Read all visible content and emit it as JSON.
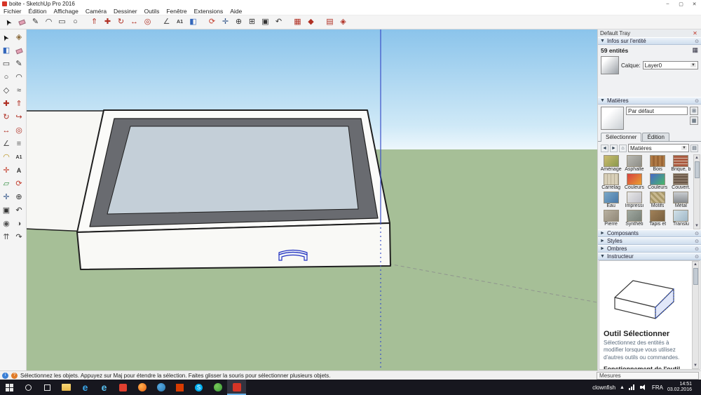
{
  "window": {
    "title": "boite - SketchUp Pro 2016"
  },
  "icons": {
    "minimize": "–",
    "maximize": "▢",
    "close": "✕",
    "chevron_down": "▼",
    "chevron_right": "►",
    "up": "▲",
    "down": "▼",
    "left": "◄",
    "right": "►",
    "home": "⌂",
    "combo_arrow": "▼",
    "detail_grid": "▦",
    "sample_paint": "▤",
    "create_material": "⊞",
    "pin": "⊙",
    "info": "i",
    "help": "?"
  },
  "menu": {
    "items": [
      {
        "name": "menu-fichier",
        "label": "Fichier"
      },
      {
        "name": "menu-edition",
        "label": "Édition"
      },
      {
        "name": "menu-affichage",
        "label": "Affichage"
      },
      {
        "name": "menu-camera",
        "label": "Caméra"
      },
      {
        "name": "menu-dessiner",
        "label": "Dessiner"
      },
      {
        "name": "menu-outils",
        "label": "Outils"
      },
      {
        "name": "menu-fenetre",
        "label": "Fenêtre"
      },
      {
        "name": "menu-extensions",
        "label": "Extensions"
      },
      {
        "name": "menu-aide",
        "label": "Aide"
      }
    ]
  },
  "toolbar": {
    "icons": [
      {
        "name": "select-tool",
        "glyph": "➤",
        "style": "color:#111;transform:rotate(-120deg)"
      },
      {
        "name": "eraser-tool",
        "glyph": "",
        "style": "background:#e2a0b4;width:9px;height:6px;transform:rotate(-20deg);border:1px solid #9a6a7a"
      },
      {
        "name": "line-tool",
        "glyph": "✎",
        "style": "color:#333"
      },
      {
        "name": "arc-tool",
        "glyph": "◠",
        "style": "color:#333"
      },
      {
        "name": "rectangle-tool",
        "glyph": "▭",
        "style": "color:#333"
      },
      {
        "name": "circle-tool",
        "glyph": "○",
        "style": "color:#333"
      },
      {
        "name": "toolbar-separator",
        "glyph": "",
        "cls": "tb-gap",
        "inter": "false"
      },
      {
        "name": "push-pull-tool",
        "glyph": "⇑",
        "style": "color:#b03024"
      },
      {
        "name": "move-tool",
        "glyph": "✚",
        "style": "color:#b03024"
      },
      {
        "name": "rotate-tool",
        "glyph": "↻",
        "style": "color:#b03024"
      },
      {
        "name": "scale-tool",
        "glyph": "↔",
        "style": "color:#b03024"
      },
      {
        "name": "offset-tool",
        "glyph": "◎",
        "style": "color:#b03024"
      },
      {
        "name": "toolbar-separator",
        "glyph": "",
        "cls": "tb-gap",
        "inter": "false"
      },
      {
        "name": "tape-measure-tool",
        "glyph": "∠",
        "style": "color:#555"
      },
      {
        "name": "text-tool",
        "glyph": "A1",
        "style": "font-size:7px;font-weight:bold;color:#333"
      },
      {
        "name": "paint-bucket-tool",
        "glyph": "◧",
        "style": "color:#3366bb"
      },
      {
        "name": "toolbar-separator",
        "glyph": "",
        "cls": "tb-gap",
        "inter": "false"
      },
      {
        "name": "orbit-tool",
        "glyph": "⟳",
        "style": "color:#c23b2a"
      },
      {
        "name": "pan-tool",
        "glyph": "✛",
        "style": "color:#335588"
      },
      {
        "name": "zoom-tool",
        "glyph": "⊕",
        "style": "color:#333"
      },
      {
        "name": "zoom-window-tool",
        "glyph": "⊞",
        "style": "color:#333"
      },
      {
        "name": "zoom-extents-tool",
        "glyph": "▣",
        "style": "color:#333"
      },
      {
        "name": "previous-view-tool",
        "glyph": "↶",
        "style": "color:#333"
      },
      {
        "name": "toolbar-separator",
        "glyph": "",
        "cls": "tb-gap",
        "inter": "false"
      },
      {
        "name": "shadows-toggle",
        "glyph": "▦",
        "style": "color:#b03024"
      },
      {
        "name": "styles-tool",
        "glyph": "◆",
        "style": "color:#b03024"
      },
      {
        "name": "toolbar-separator",
        "glyph": "",
        "cls": "tb-gap",
        "inter": "false"
      },
      {
        "name": "layers-tool",
        "glyph": "▤",
        "style": "color:#b03024"
      },
      {
        "name": "model-info-tool",
        "glyph": "◈",
        "style": "color:#b03024"
      }
    ]
  },
  "left_toolbar": {
    "icons": [
      {
        "name": "select-tool",
        "glyph": "➤",
        "style": "color:#111;transform:rotate(-120deg)"
      },
      {
        "name": "make-component-tool",
        "glyph": "◈",
        "style": "color:#8a6a3a"
      },
      {
        "name": "paint-bucket-tool",
        "glyph": "◧",
        "style": "color:#3366bb"
      },
      {
        "name": "eraser-tool",
        "glyph": "",
        "style": "background:#e2a0b4;width:9px;height:6px;transform:rotate(-20deg);border:1px solid #9a6a7a"
      },
      {
        "name": "rectangle-tool",
        "glyph": "▭",
        "style": "color:#333"
      },
      {
        "name": "line-tool",
        "glyph": "✎",
        "style": "color:#333"
      },
      {
        "name": "circle-tool",
        "glyph": "○",
        "style": "color:#333"
      },
      {
        "name": "arc-tool",
        "glyph": "◠",
        "style": "color:#333"
      },
      {
        "name": "polygon-tool",
        "glyph": "◇",
        "style": "color:#333"
      },
      {
        "name": "freehand-tool",
        "glyph": "≈",
        "style": "color:#333"
      },
      {
        "name": "move-tool",
        "glyph": "✚",
        "style": "color:#b03024"
      },
      {
        "name": "push-pull-tool",
        "glyph": "⇑",
        "style": "color:#b03024"
      },
      {
        "name": "rotate-tool",
        "glyph": "↻",
        "style": "color:#b03024"
      },
      {
        "name": "follow-me-tool",
        "glyph": "↪",
        "style": "color:#b03024"
      },
      {
        "name": "scale-tool",
        "glyph": "↔",
        "style": "color:#b03024"
      },
      {
        "name": "offset-tool",
        "glyph": "◎",
        "style": "color:#b03024"
      },
      {
        "name": "tape-measure-tool",
        "glyph": "∠",
        "style": "color:#555"
      },
      {
        "name": "dimension-tool",
        "glyph": "≡",
        "style": "color:#555"
      },
      {
        "name": "protractor-tool",
        "glyph": "◠",
        "style": "color:#b8901a"
      },
      {
        "name": "text-tool",
        "glyph": "A1",
        "style": "font-size:7px;font-weight:bold;color:#333"
      },
      {
        "name": "axes-tool",
        "glyph": "✛",
        "style": "color:#c23b2a"
      },
      {
        "name": "3d-text-tool",
        "glyph": "A",
        "style": "font-weight:bold;color:#333;font-size:9px"
      },
      {
        "name": "section-plane-tool",
        "glyph": "▱",
        "style": "color:#2a8a3a"
      },
      {
        "name": "orbit-tool",
        "glyph": "⟳",
        "style": "color:#c23b2a"
      },
      {
        "name": "pan-tool",
        "glyph": "✛",
        "style": "color:#335588"
      },
      {
        "name": "zoom-tool",
        "glyph": "⊕",
        "style": "color:#333"
      },
      {
        "name": "zoom-extents-tool",
        "glyph": "▣",
        "style": "color:#333"
      },
      {
        "name": "previous-view-tool",
        "glyph": "↶",
        "style": "color:#333"
      },
      {
        "name": "position-camera-tool",
        "glyph": "◉",
        "style": "color:#555"
      },
      {
        "name": "look-around-tool",
        "glyph": "◑",
        "style": "color:#555"
      },
      {
        "name": "walk-tool",
        "glyph": "⇈",
        "style": "color:#555"
      },
      {
        "name": "next-view-tool",
        "glyph": "↷",
        "style": "color:#333"
      }
    ]
  },
  "viewport": {
    "colors": {
      "sky_top": "#8bc4eb",
      "sky_horizon": "#eef7fc",
      "ground": "#a6bf97",
      "building_white": "#fbfbf9",
      "slope_frame_gray": "#696b70",
      "glass": "#c4cfd8",
      "edge": "#1f1f1f",
      "axis_blue": "#3a4fc8",
      "selection_blue": "#2433c0"
    }
  },
  "tray": {
    "title": "Default Tray",
    "entity_info": {
      "title": "Infos sur l'entité",
      "count": "59 entités",
      "layer_label": "Calque:",
      "layer_value": "Layer0"
    },
    "materials": {
      "title": "Matières",
      "current": "Par défaut",
      "tab_select": "Sélectionner",
      "tab_edit": "Édition",
      "dropdown": "Matières",
      "swatches": [
        {
          "name": "material-amenagement",
          "label": "Aménage",
          "thumb": "background:linear-gradient(135deg,#cdbb6e,#8a9a4e)"
        },
        {
          "name": "material-asphalte",
          "label": "Asphalte",
          "thumb": "background:linear-gradient(135deg,#b9b9b3,#8d8d87)"
        },
        {
          "name": "material-bois",
          "label": "Bois",
          "thumb": "background:repeating-linear-gradient(90deg,#b07a45 0,#b07a45 3px,#9a6636 3px,#9a6636 6px)"
        },
        {
          "name": "material-brique",
          "label": "Brique, b",
          "thumb": "background:repeating-linear-gradient(0deg,#aa5a40 0,#aa5a40 3px,#d8c0b0 3px,#d8c0b0 4px)"
        },
        {
          "name": "material-carrelage",
          "label": "Carrelag",
          "thumb": "background:repeating-linear-gradient(90deg,#d8cfb8 0,#d8cfb8 4px,#b8af98 4px,#b8af98 5px)"
        },
        {
          "name": "material-couleurs",
          "label": "Couleurs",
          "thumb": "background:linear-gradient(135deg,#d84040,#e8a030)"
        },
        {
          "name": "material-couleurs-nommees",
          "label": "Couleurs",
          "thumb": "background:linear-gradient(135deg,#4868c8,#48b868)"
        },
        {
          "name": "material-couvertures",
          "label": "Couvert.",
          "thumb": "background:repeating-linear-gradient(0deg,#8a7868 0,#8a7868 2px,#6a5848 2px,#6a5848 4px)"
        },
        {
          "name": "material-eau",
          "label": "Eau",
          "thumb": "background:linear-gradient(135deg,#7aa8c8,#4878a8)"
        },
        {
          "name": "material-impression",
          "label": "Impressi",
          "thumb": "background:linear-gradient(135deg,#e8e8e8,#c0c0c8)"
        },
        {
          "name": "material-motifs",
          "label": "Motifs",
          "thumb": "background:repeating-linear-gradient(45deg,#c8b890 0,#c8b890 3px,#a89868 3px,#a89868 6px)"
        },
        {
          "name": "material-metal",
          "label": "Métal",
          "thumb": "background:linear-gradient(180deg,#c8ccd0,#888c90)"
        },
        {
          "name": "material-pierre",
          "label": "Pierre",
          "thumb": "background:linear-gradient(135deg,#b8b0a0,#908878)"
        },
        {
          "name": "material-synthetique",
          "label": "Synthéti",
          "thumb": "background:linear-gradient(135deg,#a0a8a0,#788078)"
        },
        {
          "name": "material-tapis",
          "label": "Tapis et",
          "thumb": "background:linear-gradient(135deg,#a08058,#786040)"
        },
        {
          "name": "material-translucide",
          "label": "Translu",
          "thumb": "background:linear-gradient(135deg,#d0e0e8,#a0b8c8)"
        }
      ]
    },
    "sections": [
      {
        "name": "section-composants",
        "label": "Composants"
      },
      {
        "name": "section-styles",
        "label": "Styles"
      },
      {
        "name": "section-ombres",
        "label": "Ombres"
      }
    ],
    "instructor": {
      "title": "Instructeur",
      "heading": "Outil Sélectionner",
      "body": "Sélectionnez des entités à modifier lorsque vous utilisez d'autres outils ou commandes.",
      "subheading": "Fonctionnement de l'outil"
    }
  },
  "statusbar": {
    "message": "Sélectionnez les objets. Appuyez sur Maj pour étendre la sélection. Faites glisser la souris pour sélectionner plusieurs objets.",
    "measure_label": "Mesures"
  },
  "taskbar": {
    "apps": [
      {
        "name": "taskbar-file-explorer",
        "glyph": "",
        "style": "background:linear-gradient(180deg,#f8d878,#e8b84a);width:13px;height:10px;border-radius:1px"
      },
      {
        "name": "taskbar-edge",
        "glyph": "e",
        "style": "color:#3ba7ea;font-weight:bold;font-size:14px"
      },
      {
        "name": "taskbar-internet-explorer",
        "glyph": "e",
        "style": "color:#58c0f0;font-weight:bold;font-size:14px"
      },
      {
        "name": "taskbar-pdf-reader",
        "glyph": "",
        "style": "background:#e04030;width:11px;height:11px;border-radius:2px"
      },
      {
        "name": "taskbar-firefox",
        "glyph": "",
        "style": "background:radial-gradient(circle at 35% 35%,#ffb050,#e86010);width:12px;height:12px;border-radius:50%"
      },
      {
        "name": "taskbar-thunderbird",
        "glyph": "",
        "style": "background:radial-gradient(circle at 35% 35%,#58a8e0,#2878b0);width:12px;height:12px;border-radius:50%"
      },
      {
        "name": "taskbar-office",
        "glyph": "",
        "style": "background:#d83b01;width:11px;height:11px"
      },
      {
        "name": "taskbar-skype",
        "glyph": "S",
        "style": "color:#fff;background:#00aff0;width:11px;height:11px;border-radius:50%;font-size:8px;text-align:center;line-height:11px"
      },
      {
        "name": "taskbar-openoffice",
        "glyph": "",
        "style": "background:radial-gradient(circle at 35% 35%,#78c858,#389838);width:12px;height:12px;border-radius:50%"
      },
      {
        "name": "taskbar-sketchup",
        "glyph": "",
        "cls": "active",
        "style": "background:#d63426;width:12px;height:12px;border-radius:2px"
      }
    ],
    "tray_label": "clownfish",
    "language": "FRA",
    "time": "14:51",
    "date": "03.02.2016"
  }
}
